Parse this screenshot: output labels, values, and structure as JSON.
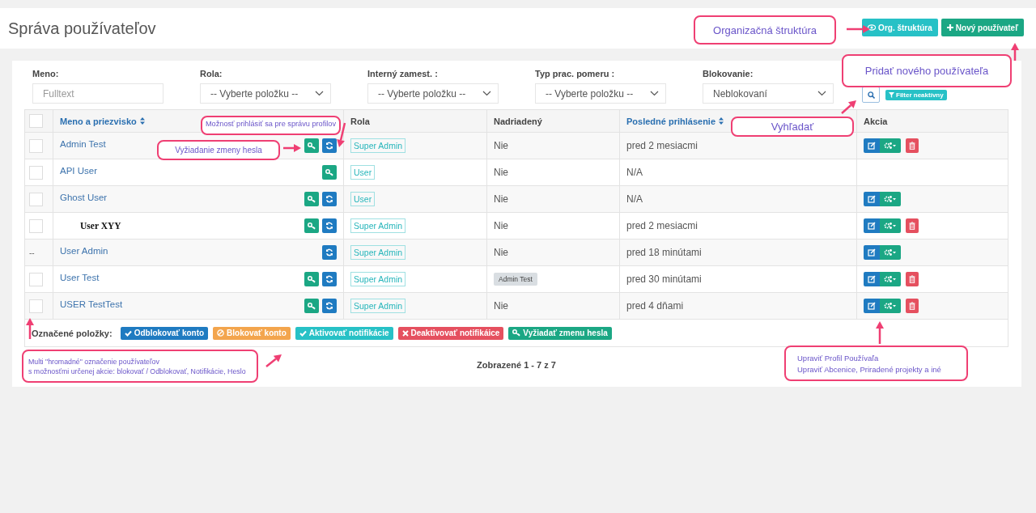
{
  "page": {
    "title": "Správa používateľov"
  },
  "header_buttons": [
    {
      "label": "Org. štruktúra",
      "kind": "eye",
      "color": "#27c1c6"
    },
    {
      "label": "Nový používateľ",
      "kind": "plus",
      "color": "#1ba784"
    }
  ],
  "filters": [
    {
      "label": "Meno:",
      "kind": "text",
      "placeholder": "Fulltext"
    },
    {
      "label": "Rola:",
      "kind": "select",
      "value": "-- Vyberte položku --"
    },
    {
      "label": "Interný zamest. :",
      "kind": "select",
      "value": "-- Vyberte položku --"
    },
    {
      "label": "Typ prac. pomeru :",
      "kind": "select",
      "value": "-- Vyberte položku --"
    },
    {
      "label": "Blokovanie:",
      "kind": "select",
      "value": "Neblokovaní"
    }
  ],
  "filter_badge": "Filter neaktívny",
  "table": {
    "select_all": {
      "checked": false
    },
    "columns": [
      {
        "label": "Meno a priezvisko",
        "sortable": true
      },
      {
        "label": "Rola",
        "sortable": false
      },
      {
        "label": "Nadriadený",
        "sortable": false
      },
      {
        "label": "Posledné prihlásenie",
        "sortable": true
      },
      {
        "label": "Akcia",
        "sortable": false
      }
    ],
    "rows": [
      {
        "checked": false,
        "name": "Admin Test",
        "kind": "link",
        "can_login": true,
        "can_reset": true,
        "role": "Super Admin",
        "manager": {
          "kind": "text",
          "text": "Nie"
        },
        "last_login": "pred 2 mesiacmi",
        "editable": true,
        "deletable": true
      },
      {
        "checked": false,
        "name": "API User",
        "kind": "link",
        "can_login": true,
        "can_reset": false,
        "role": "User",
        "manager": {
          "kind": "text",
          "text": "Nie"
        },
        "last_login": "N/A",
        "editable": false,
        "deletable": false
      },
      {
        "checked": false,
        "name": "Ghost User",
        "kind": "link",
        "can_login": true,
        "can_reset": true,
        "role": "User",
        "manager": {
          "kind": "text",
          "text": "Nie"
        },
        "last_login": "N/A",
        "editable": true,
        "deletable": false
      },
      {
        "checked": false,
        "name": "User XYY",
        "kind": "plain",
        "can_login": true,
        "can_reset": true,
        "role": "Super Admin",
        "manager": {
          "kind": "text",
          "text": "Nie"
        },
        "last_login": "pred 2 mesiacmi",
        "editable": true,
        "deletable": true
      },
      {
        "select_text": "--",
        "name": "User Admin",
        "kind": "link",
        "can_login": false,
        "can_reset": true,
        "role": "Super Admin",
        "manager": {
          "kind": "text",
          "text": "Nie"
        },
        "last_login": "pred 18 minútami",
        "editable": true,
        "deletable": false
      },
      {
        "checked": false,
        "name": "User Test",
        "kind": "link",
        "can_login": true,
        "can_reset": true,
        "role": "Super Admin",
        "manager": {
          "kind": "tag",
          "text": "Admin Test"
        },
        "last_login": "pred 30 minútami",
        "editable": true,
        "deletable": true
      },
      {
        "checked": false,
        "name": "USER TestTest",
        "kind": "link",
        "can_login": true,
        "can_reset": true,
        "role": "Super Admin",
        "manager": {
          "kind": "text",
          "text": "Nie"
        },
        "last_login": "pred 4 dňami",
        "editable": true,
        "deletable": true
      }
    ]
  },
  "bulk": {
    "label": "Označené položky:",
    "actions": [
      {
        "label": "Odblokovať konto",
        "kind": "check",
        "color": "#1f7bc1"
      },
      {
        "label": "Blokovať konto",
        "kind": "ban",
        "color": "#f3a54d"
      },
      {
        "label": "Aktivovať notifikácie",
        "kind": "check",
        "color": "#27c1c6"
      },
      {
        "label": "Deaktivovať notifikáice",
        "kind": "times",
        "color": "#e5505f"
      },
      {
        "label": "Vyžiadať zmenu hesla",
        "kind": "key",
        "color": "#1ba784"
      }
    ]
  },
  "pagination": "Zobrazené 1 - 7 z 7",
  "annotations": [
    {
      "lines": [
        "Organizačná štruktúra"
      ]
    },
    {
      "lines": [
        "Pridať nového používateľa"
      ]
    },
    {
      "lines": [
        "Vyhľadať"
      ]
    },
    {
      "lines": [
        "Možnosť prihlásiť sa pre správu profilov"
      ]
    },
    {
      "lines": [
        "Vyžiadanie zmeny hesla"
      ]
    },
    {
      "lines": [
        "Multi \"hromadné\" označenie používateľov",
        "s možnosťmi určenej akcie: blokovať / Odblokovať, Notifikácie, Heslo"
      ]
    },
    {
      "lines": [
        "Upraviť Profil Používaľa",
        "Upraviť Abcenice, Priradené projekty a iné"
      ]
    }
  ]
}
